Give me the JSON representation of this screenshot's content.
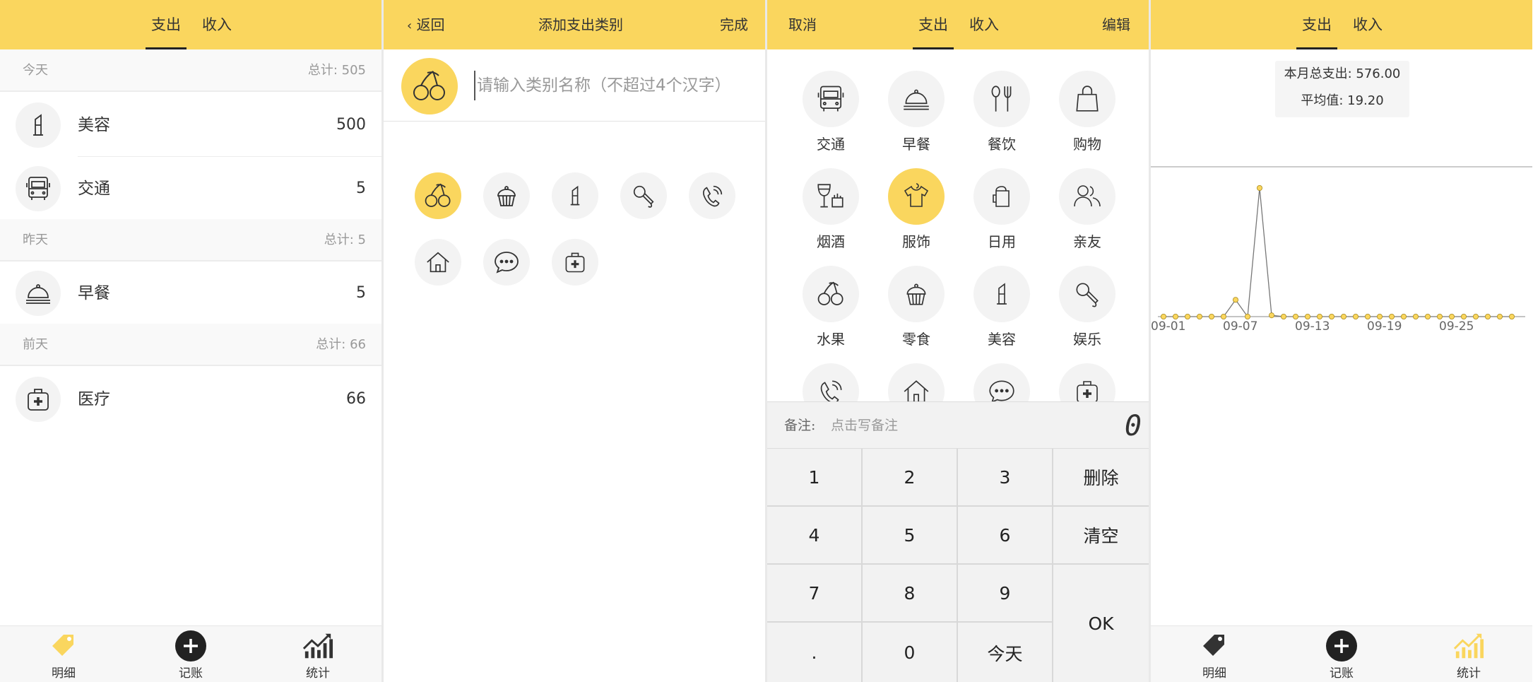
{
  "colors": {
    "accent": "#fad65e",
    "text": "#333333",
    "muted": "#999999",
    "panel_bg": "#f3f3f3"
  },
  "detail": {
    "tabs": [
      "支出",
      "收入"
    ],
    "groups": [
      {
        "day": "今天",
        "total": "总计: 505",
        "items": [
          {
            "icon": "lipstick-icon",
            "name": "美容",
            "amount": "500"
          },
          {
            "icon": "bus-icon",
            "name": "交通",
            "amount": "5"
          }
        ]
      },
      {
        "day": "昨天",
        "total": "总计: 5",
        "items": [
          {
            "icon": "food-cloche-icon",
            "name": "早餐",
            "amount": "5"
          }
        ]
      },
      {
        "day": "前天",
        "total": "总计: 66",
        "items": [
          {
            "icon": "medical-kit-icon",
            "name": "医疗",
            "amount": "66"
          }
        ]
      }
    ]
  },
  "tabbar": {
    "detail": "明细",
    "record": "记账",
    "stats": "统计"
  },
  "add_category": {
    "back": "返回",
    "title": "添加支出类别",
    "done": "完成",
    "placeholder": "请输入类别名称（不超过4个汉字）",
    "icons": [
      "cherry-icon",
      "cupcake-icon",
      "lipstick-icon",
      "microphone-icon",
      "phone-icon",
      "house-icon",
      "chat-icon",
      "medical-kit-icon"
    ]
  },
  "record": {
    "cancel": "取消",
    "tabs": [
      "支出",
      "收入"
    ],
    "edit": "编辑",
    "categories": [
      {
        "icon": "bus-icon",
        "name": "交通"
      },
      {
        "icon": "food-cloche-icon",
        "name": "早餐"
      },
      {
        "icon": "utensils-icon",
        "name": "餐饮"
      },
      {
        "icon": "shopping-bag-icon",
        "name": "购物"
      },
      {
        "icon": "wine-icon",
        "name": "烟酒"
      },
      {
        "icon": "shirt-icon",
        "name": "服饰"
      },
      {
        "icon": "tissue-icon",
        "name": "日用"
      },
      {
        "icon": "people-icon",
        "name": "亲友"
      },
      {
        "icon": "cherry-icon",
        "name": "水果"
      },
      {
        "icon": "cupcake-icon",
        "name": "零食"
      },
      {
        "icon": "lipstick-icon",
        "name": "美容"
      },
      {
        "icon": "microphone-icon",
        "name": "娱乐"
      },
      {
        "icon": "phone-icon",
        "name": ""
      },
      {
        "icon": "house-icon",
        "name": ""
      },
      {
        "icon": "chat-icon",
        "name": ""
      },
      {
        "icon": "medical-kit-icon",
        "name": ""
      }
    ],
    "note_label": "备注:",
    "note_placeholder": "点击写备注",
    "amount": "0",
    "keys": [
      "1",
      "2",
      "3",
      "删除",
      "4",
      "5",
      "6",
      "清空",
      "7",
      "8",
      "9",
      "OK",
      ".",
      "0",
      "今天"
    ]
  },
  "stats": {
    "tabs": [
      "支出",
      "收入"
    ],
    "total": "本月总支出: 576.00",
    "average": "平均值: 19.20"
  },
  "chart_data": {
    "type": "line",
    "x": [
      "09-01",
      "09-02",
      "09-03",
      "09-04",
      "09-05",
      "09-06",
      "09-07",
      "09-08",
      "09-09",
      "09-10",
      "09-11",
      "09-12",
      "09-13",
      "09-14",
      "09-15",
      "09-16",
      "09-17",
      "09-18",
      "09-19",
      "09-20",
      "09-21",
      "09-22",
      "09-23",
      "09-24",
      "09-25",
      "09-26",
      "09-27",
      "09-28",
      "09-29",
      "09-30"
    ],
    "tick_labels": [
      "09-01",
      "09-07",
      "09-13",
      "09-19",
      "09-25"
    ],
    "values": [
      0,
      0,
      0,
      0,
      0,
      0,
      66,
      0,
      505,
      5,
      0,
      0,
      0,
      0,
      0,
      0,
      0,
      0,
      0,
      0,
      0,
      0,
      0,
      0,
      0,
      0,
      0,
      0,
      0,
      0
    ],
    "ylim": [
      0,
      505
    ],
    "grid": false
  }
}
